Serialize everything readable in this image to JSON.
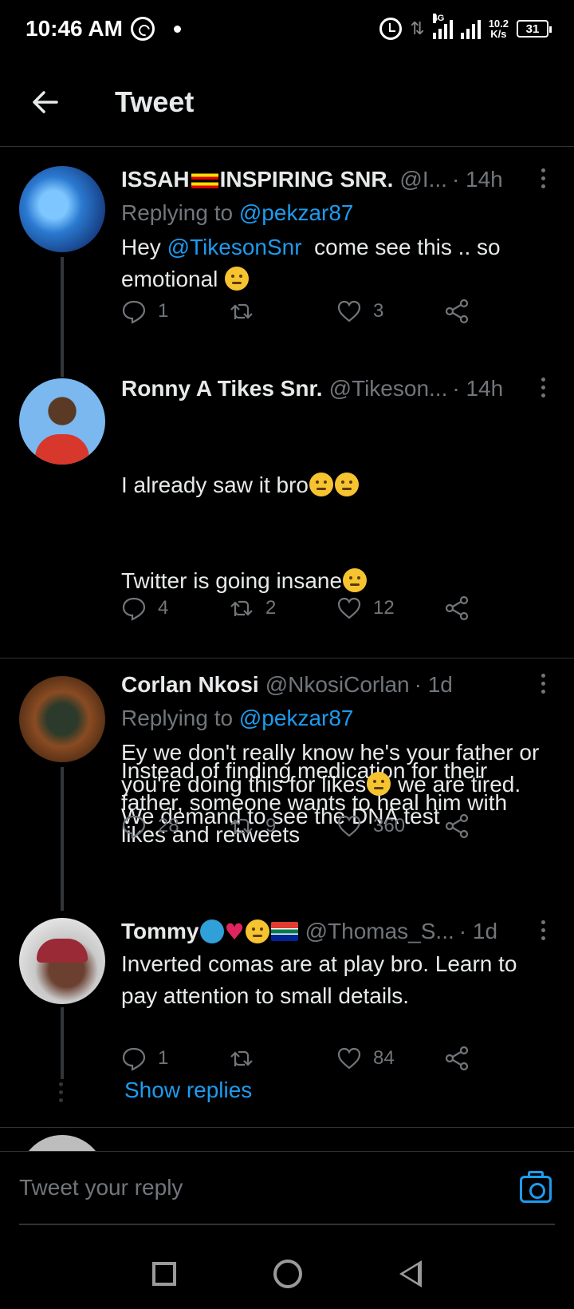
{
  "status_bar": {
    "time": "10:46 AM",
    "network_type": "4G",
    "speed_value": "10.2",
    "speed_unit": "K/s",
    "battery": "31"
  },
  "header": {
    "title": "Tweet"
  },
  "tweets": [
    {
      "name": "ISSAH",
      "name_suffix": "INSPIRING SNR.",
      "handle": "@I...",
      "time": "· 14h",
      "replying_prefix": "Replying to ",
      "replying_to": "@pekzar87",
      "text_prefix": "Hey ",
      "mention": "@TikesonSnr",
      "text_rest": "  come see this .. so emotional ",
      "replies": "1",
      "retweets": "",
      "likes": "3"
    },
    {
      "name": "Ronny A Tikes Snr.",
      "handle": "@Tikeson...",
      "time": "· 14h",
      "line1": "I already saw it bro",
      "line2": "Twitter is going insane",
      "paragraph": "Instead of finding medication for their father, someone wants to heal him with likes and retweets",
      "replies": "4",
      "retweets": "2",
      "likes": "12"
    },
    {
      "name": "Corlan Nkosi",
      "handle": "@NkosiCorlan",
      "time": "· 1d",
      "replying_prefix": "Replying to ",
      "replying_to": "@pekzar87",
      "text_a": "Ey we don't really know he's your father or you're doing this for likes",
      "text_b": " we are tired. We demand to see the DNA test",
      "replies": "28",
      "retweets": "9",
      "likes": "360"
    },
    {
      "name": "Tommy",
      "handle": "@Thomas_S...",
      "time": "· 1d",
      "text": "Inverted comas are at play bro. Learn to pay attention to small details.",
      "replies": "1",
      "retweets": "",
      "likes": "84"
    }
  ],
  "show_replies": "Show replies",
  "reply_bar": {
    "placeholder": "Tweet your reply"
  },
  "icons": {
    "back": "arrow-left-icon",
    "reply": "speech-bubble-icon",
    "retweet": "retweet-icon",
    "like": "heart-icon",
    "share": "share-icon",
    "camera": "camera-icon"
  },
  "colors": {
    "background": "#000000",
    "link": "#1d9bf0",
    "secondary_text": "#71767b",
    "primary_text": "#e7e9ea",
    "divider": "#2f3336"
  }
}
